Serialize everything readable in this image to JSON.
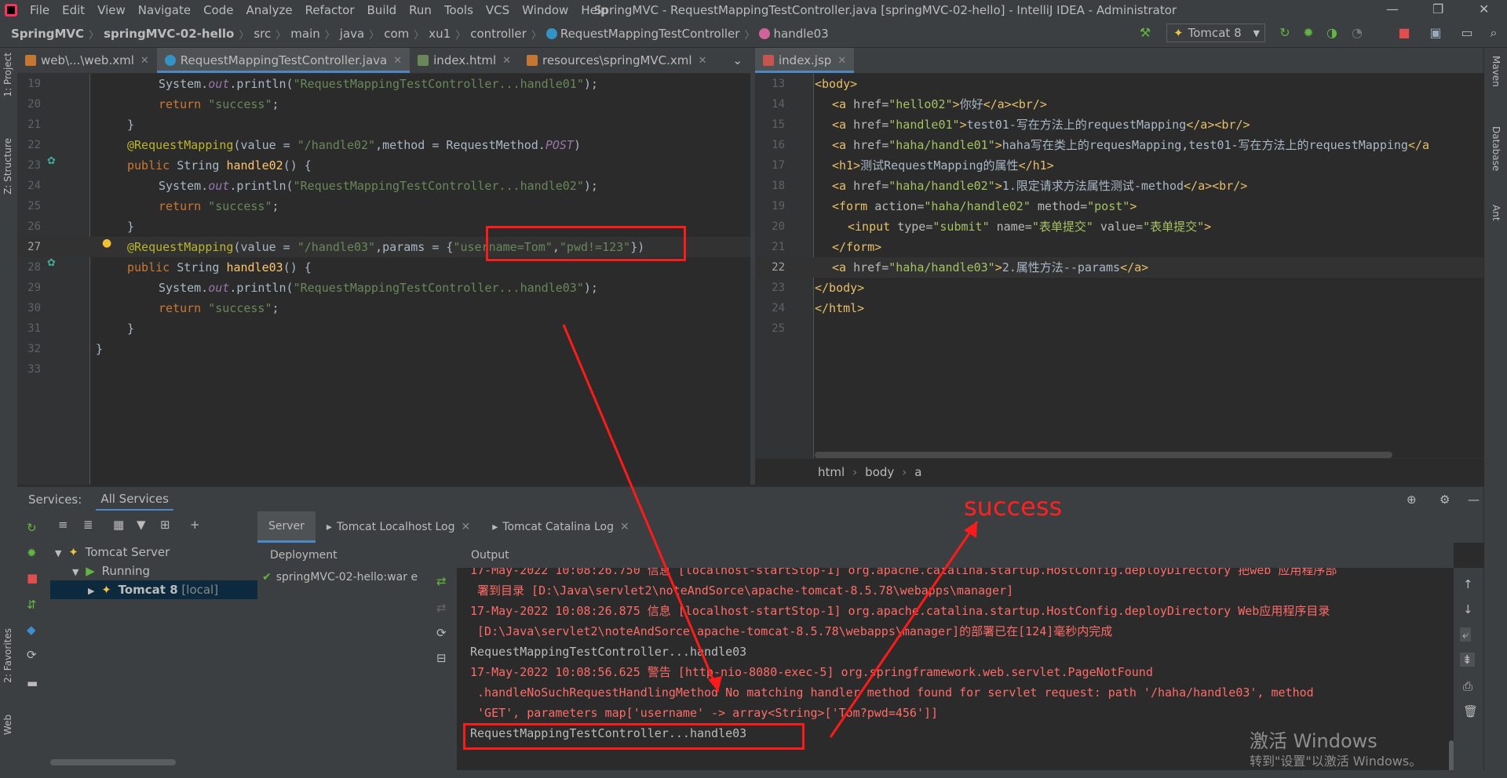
{
  "menubar": {
    "items": [
      "File",
      "Edit",
      "View",
      "Navigate",
      "Code",
      "Analyze",
      "Refactor",
      "Build",
      "Run",
      "Tools",
      "VCS",
      "Window",
      "Help"
    ],
    "window_title": "SpringMVC - RequestMappingTestController.java [springMVC-02-hello] - IntelliJ IDEA - Administrator"
  },
  "navbar": {
    "crumbs": [
      "SpringMVC",
      "springMVC-02-hello",
      "src",
      "main",
      "java",
      "com",
      "xu1",
      "controller",
      "RequestMappingTestController",
      "handle03"
    ],
    "run_config": "Tomcat 8"
  },
  "left_tabs": [
    {
      "label": "web\\...\\web.xml"
    },
    {
      "label": "RequestMappingTestController.java"
    },
    {
      "label": "index.html"
    },
    {
      "label": "resources\\springMVC.xml"
    }
  ],
  "right_tabs": [
    {
      "label": "index.jsp"
    }
  ],
  "left_strip": {
    "project": "1: Project",
    "structure": "Z: Structure",
    "favorites": "2: Favorites",
    "web": "Web"
  },
  "right_strip": {
    "maven": "Maven",
    "database": "Database",
    "ant": "Ant"
  },
  "left_code": {
    "line_numbers": [
      "19",
      "20",
      "21",
      "22",
      "23",
      "24",
      "25",
      "26",
      "27",
      "28",
      "29",
      "30",
      "31",
      "32",
      "33"
    ],
    "current_line": "27"
  },
  "right_code": {
    "line_numbers": [
      "13",
      "14",
      "15",
      "16",
      "17",
      "18",
      "19",
      "20",
      "21",
      "22",
      "23",
      "24",
      "25"
    ],
    "current_line": "22",
    "breadcrumb": [
      "html",
      "body",
      "a"
    ]
  },
  "services": {
    "title": "Services:",
    "scope_tab": "All Services",
    "tree": {
      "root": "Tomcat Server",
      "running": "Running",
      "instance": "Tomcat 8",
      "instance_suffix": "[local]"
    },
    "tabs": [
      "Server",
      "Tomcat Localhost Log",
      "Tomcat Catalina Log"
    ],
    "deployment_header": "Deployment",
    "deployment_item": "springMVC-02-hello:war e",
    "output_header": "Output",
    "output_lines": [
      {
        "text": "17-May-2022 10:08:26.750 信息 [localhost-startStop-1] org.apache.catalina.startup.HostConfig.deployDirectory 把web 应用程序部",
        "color": "red"
      },
      {
        "text": " 署到目录 [D:\\Java\\servlet2\\noteAndSorce\\apache-tomcat-8.5.78\\webapps\\manager]",
        "color": "red"
      },
      {
        "text": "17-May-2022 10:08:26.875 信息 [localhost-startStop-1] org.apache.catalina.startup.HostConfig.deployDirectory Web应用程序目录",
        "color": "red"
      },
      {
        "text": " [D:\\Java\\servlet2\\noteAndSorce\\apache-tomcat-8.5.78\\webapps\\manager]的部署已在[124]毫秒内完成",
        "color": "red"
      },
      {
        "text": "RequestMappingTestController...handle03",
        "color": "white"
      },
      {
        "text": "17-May-2022 10:08:56.625 警告 [http-nio-8080-exec-5] org.springframework.web.servlet.PageNotFound",
        "color": "red"
      },
      {
        "text": " .handleNoSuchRequestHandlingMethod No matching handler method found for servlet request: path '/haha/handle03', method",
        "color": "red"
      },
      {
        "text": " 'GET', parameters map['username' -> array<String>['Tom?pwd=456']]",
        "color": "red"
      },
      {
        "text": "RequestMappingTestController...handle03",
        "color": "white"
      }
    ]
  },
  "annotation": {
    "success_label": "success"
  },
  "watermark": {
    "line1": "激活 Windows",
    "line2": "转到\"设置\"以激活 Windows。"
  },
  "icons": {
    "close": "close-icon",
    "chevron": "chevron-down-icon",
    "gear": "gear-icon",
    "hammer": "hammer-icon",
    "run": "run-icon",
    "debug": "debug-icon",
    "stop": "stop-icon",
    "search": "search-icon"
  },
  "colors": {
    "accent": "#4a88c7",
    "annotation_red": "#ff1a1a",
    "keyword": "#cc7832",
    "string": "#6a8759"
  }
}
